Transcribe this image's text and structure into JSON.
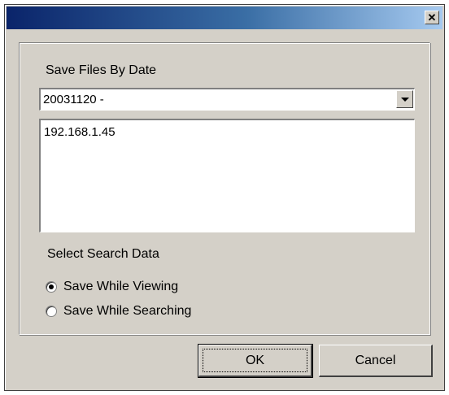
{
  "window": {
    "title": "",
    "close_glyph": "✕"
  },
  "save_files": {
    "label": "Save Files By Date",
    "selected_date": "20031120 -",
    "list_items": [
      "192.168.1.45"
    ]
  },
  "search_data": {
    "label": "Select Search Data",
    "options": [
      {
        "label": "Save While Viewing",
        "checked": true
      },
      {
        "label": "Save While Searching",
        "checked": false
      }
    ]
  },
  "buttons": {
    "ok": "OK",
    "cancel": "Cancel"
  }
}
